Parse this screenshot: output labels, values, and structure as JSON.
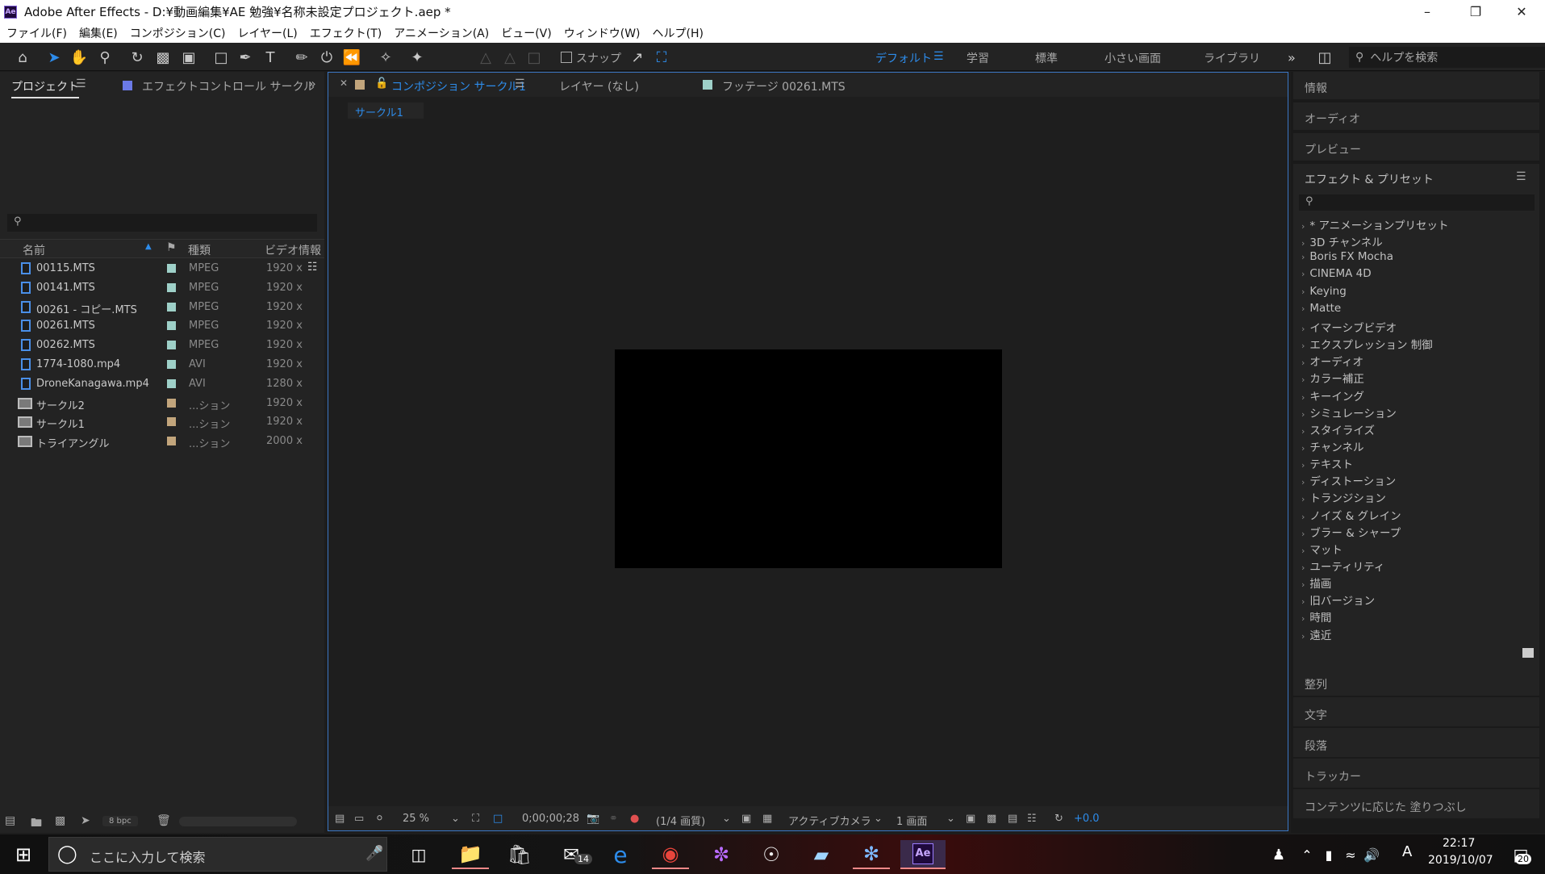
{
  "window": {
    "title": "Adobe After Effects - D:¥動画編集¥AE 勉強¥名称未設定プロジェクト.aep *",
    "logo_text": "Ae"
  },
  "menu": [
    "ファイル(F)",
    "編集(E)",
    "コンポジション(C)",
    "レイヤー(L)",
    "エフェクト(T)",
    "アニメーション(A)",
    "ビュー(V)",
    "ウィンドウ(W)",
    "ヘルプ(H)"
  ],
  "toolbar": {
    "snap_label": "スナップ",
    "workspaces": [
      "デフォルト",
      "学習",
      "標準",
      "小さい画面",
      "ライブラリ"
    ],
    "help_search_placeholder": "ヘルプを検索"
  },
  "project_panel": {
    "tabs": [
      "プロジェクト",
      "エフェクトコントロール サークル"
    ],
    "columns": [
      "名前",
      "種類",
      "ビデオ情報"
    ],
    "files": [
      {
        "name": "00115.MTS",
        "type": "MPEG",
        "video": "1920 x",
        "kind": "footage",
        "color": "#9ed0c8"
      },
      {
        "name": "00141.MTS",
        "type": "MPEG",
        "video": "1920 x",
        "kind": "footage",
        "color": "#9ed0c8"
      },
      {
        "name": "00261 - コピー.MTS",
        "type": "MPEG",
        "video": "1920 x",
        "kind": "footage",
        "color": "#9ed0c8"
      },
      {
        "name": "00261.MTS",
        "type": "MPEG",
        "video": "1920 x",
        "kind": "footage",
        "color": "#9ed0c8"
      },
      {
        "name": "00262.MTS",
        "type": "MPEG",
        "video": "1920 x",
        "kind": "footage",
        "color": "#9ed0c8"
      },
      {
        "name": "1774-1080.mp4",
        "type": "AVI",
        "video": "1920 x",
        "kind": "footage",
        "color": "#9ed0c8"
      },
      {
        "name": "DroneKanagawa.mp4",
        "type": "AVI",
        "video": "1280 x",
        "kind": "footage",
        "color": "#9ed0c8"
      },
      {
        "name": "サークル2",
        "type": "...ション",
        "video": "1920 x",
        "kind": "comp",
        "color": "#c2a57c"
      },
      {
        "name": "サークル1",
        "type": "...ション",
        "video": "1920 x",
        "kind": "comp",
        "color": "#c2a57c"
      },
      {
        "name": "トライアングル",
        "type": "...ション",
        "video": "2000 x",
        "kind": "comp",
        "color": "#c2a57c"
      }
    ],
    "bpc": "8 bpc"
  },
  "viewer": {
    "tabs": [
      "コンポジション サークル1",
      "レイヤー (なし)",
      "フッテージ 00261.MTS"
    ],
    "breadcrumb": "サークル1",
    "zoom": "25 %",
    "timecode": "0;00;00;28",
    "resolution": "(1/4 画質)",
    "camera": "アクティブカメラ",
    "views": "1 画面",
    "exposure": "+0.0"
  },
  "right_panels": {
    "top": [
      "情報",
      "オーディオ",
      "プレビュー"
    ],
    "effects_title": "エフェクト & プリセット",
    "effects_items": [
      "* アニメーションプリセット",
      "3D チャンネル",
      "Boris FX Mocha",
      "CINEMA 4D",
      "Keying",
      "Matte",
      "イマーシブビデオ",
      "エクスプレッション 制御",
      "オーディオ",
      "カラー補正",
      "キーイング",
      "シミュレーション",
      "スタイライズ",
      "チャンネル",
      "テキスト",
      "ディストーション",
      "トランジション",
      "ノイズ & グレイン",
      "ブラー & シャープ",
      "マット",
      "ユーティリティ",
      "描画",
      "旧バージョン",
      "時間",
      "遠近"
    ],
    "bottom": [
      "整列",
      "文字",
      "段落",
      "トラッカー",
      "コンテンツに応じた 塗りつぶし"
    ]
  },
  "taskbar": {
    "search_placeholder": "ここに入力して検索",
    "mail_badge": "14",
    "time": "22:17",
    "date": "2019/10/07",
    "notif_badge": "20",
    "ime": "A"
  }
}
